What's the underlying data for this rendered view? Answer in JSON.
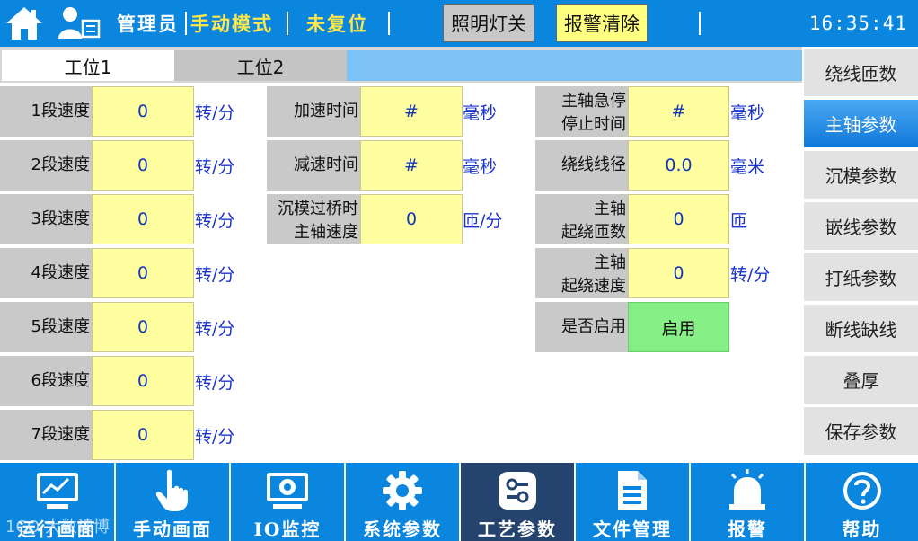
{
  "header": {
    "user_role": "管理员",
    "mode": "手动模式",
    "reset_status": "未复位",
    "light_button": "照明灯关",
    "alarm_clear_button": "报警清除",
    "time": "16:35:41"
  },
  "tabs": [
    {
      "label": "工位1",
      "active": true
    },
    {
      "label": "工位2",
      "active": false
    }
  ],
  "speed_column": [
    {
      "label": "1段速度",
      "value": "0",
      "unit": "转/分"
    },
    {
      "label": "2段速度",
      "value": "0",
      "unit": "转/分"
    },
    {
      "label": "3段速度",
      "value": "0",
      "unit": "转/分"
    },
    {
      "label": "4段速度",
      "value": "0",
      "unit": "转/分"
    },
    {
      "label": "5段速度",
      "value": "0",
      "unit": "转/分"
    },
    {
      "label": "6段速度",
      "value": "0",
      "unit": "转/分"
    },
    {
      "label": "7段速度",
      "value": "0",
      "unit": "转/分"
    }
  ],
  "middle_column": [
    {
      "label": "加速时间",
      "value": "#",
      "unit": "毫秒"
    },
    {
      "label": "减速时间",
      "value": "#",
      "unit": "毫秒"
    },
    {
      "label_line1": "沉模过桥时",
      "label_line2": "主轴速度",
      "value": "0",
      "unit": "匝/分"
    }
  ],
  "right_column": [
    {
      "label_line1": "主轴急停",
      "label_line2": "停止时间",
      "value": "#",
      "unit": "毫秒"
    },
    {
      "label_line1": "绕线线径",
      "label_line2": "",
      "value": "0.0",
      "unit": "毫米"
    },
    {
      "label_line1": "主轴",
      "label_line2": "起绕匝数",
      "value": "0",
      "unit": "匝"
    },
    {
      "label_line1": "主轴",
      "label_line2": "起绕速度",
      "value": "0",
      "unit": "转/分"
    },
    {
      "label_line1": "是否启用",
      "label_line2": "",
      "value": "启用",
      "unit": ""
    }
  ],
  "side_menu": [
    {
      "label": "绕线匝数",
      "active": false
    },
    {
      "label": "主轴参数",
      "active": true
    },
    {
      "label": "沉模参数",
      "active": false
    },
    {
      "label": "嵌线参数",
      "active": false
    },
    {
      "label": "打纸参数",
      "active": false
    },
    {
      "label": "断线缺线",
      "active": false
    },
    {
      "label": "叠厚",
      "active": false
    },
    {
      "label": "保存参数",
      "active": false
    }
  ],
  "bottom_nav": [
    {
      "label": "运行画面",
      "icon": "chart-monitor-icon",
      "active": false
    },
    {
      "label": "手动画面",
      "icon": "hand-pointer-icon",
      "active": false
    },
    {
      "label": "IO监控",
      "icon": "io-monitor-icon",
      "active": false
    },
    {
      "label": "系统参数",
      "icon": "gear-icon",
      "active": false
    },
    {
      "label": "工艺参数",
      "icon": "sliders-icon",
      "active": true
    },
    {
      "label": "文件管理",
      "icon": "document-icon",
      "active": false
    },
    {
      "label": "报警",
      "icon": "alarm-bell-icon",
      "active": false
    },
    {
      "label": "帮助",
      "icon": "help-icon",
      "active": false
    }
  ],
  "watermark": "1CO 大数读博",
  "colors": {
    "bar_blue": "#0a86df",
    "active_nav": "#24436e",
    "value_yellow": "#ffff9f",
    "enable_green": "#86f086",
    "tab_fill": "#7ec3f6",
    "mode_yellow": "#ffe84a"
  }
}
